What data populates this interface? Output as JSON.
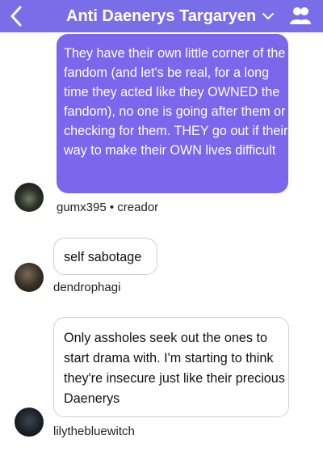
{
  "header": {
    "title": "Anti Daenerys Targaryen",
    "accent_color": "#7a6ee8",
    "back_icon": "chevron-left-icon",
    "dropdown_icon": "chevron-down-icon",
    "members_icon": "people-icon"
  },
  "messages": [
    {
      "text": "They have their own little corner of the fandom (and let's be real, for a long time they acted like they OWNED the fandom), no one is going after them or checking for them. THEY go out if their way to make their OWN lives difficult",
      "author": "gumx395 • creador",
      "bubble_color": "#7c66ec"
    },
    {
      "text": "self sabotage",
      "author": "dendrophagi"
    },
    {
      "text": "Only assholes seek out the ones to start drama with. I'm starting to think they're insecure just like their precious Daenerys",
      "author": "lilythebluewitch"
    }
  ]
}
